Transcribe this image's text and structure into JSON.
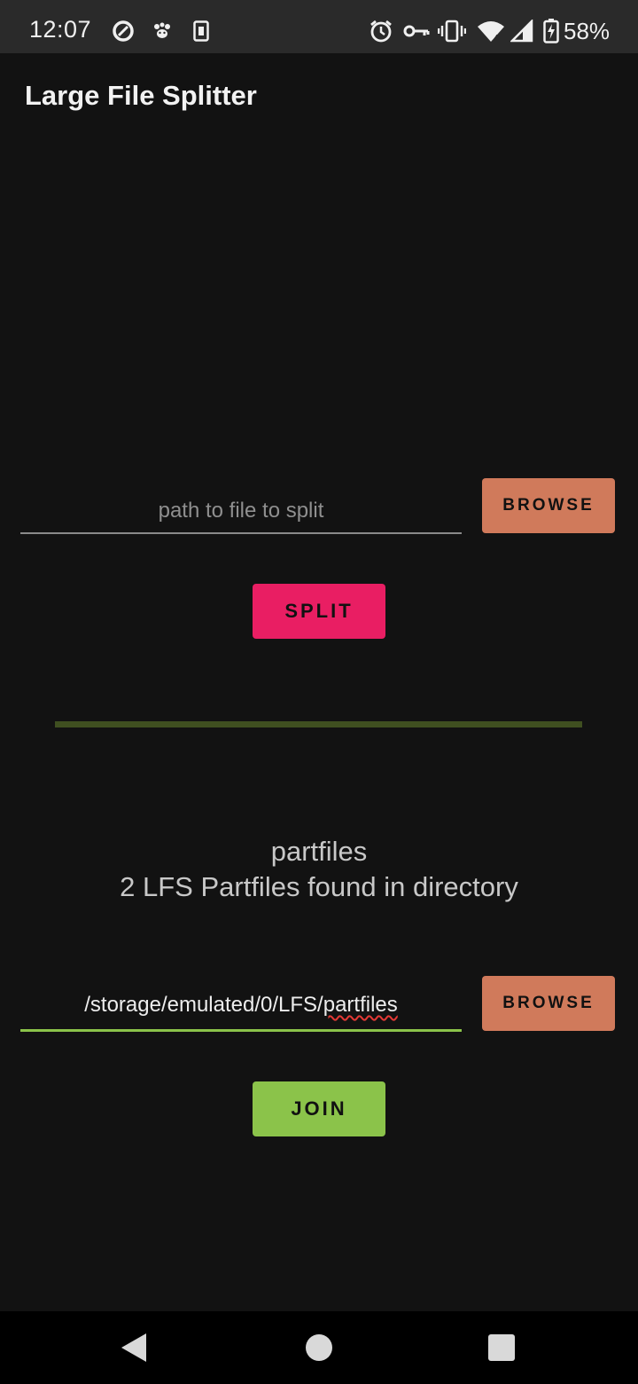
{
  "status_bar": {
    "time": "12:07",
    "battery_percent": "58%",
    "left_icons": [
      "data-saver-icon",
      "paw-icon",
      "sim-card-icon"
    ],
    "right_icons": [
      "alarm-icon",
      "vpn-key-icon",
      "vibrate-icon",
      "wifi-icon",
      "signal-icon",
      "battery-charging-icon"
    ]
  },
  "app_bar": {
    "title": "Large File Splitter"
  },
  "split_section": {
    "input_value": "",
    "input_placeholder": "path to file to split",
    "browse_label": "BROWSE",
    "split_label": "SPLIT",
    "progress": 0
  },
  "join_section": {
    "directory_name": "partfiles",
    "found_text": "2 LFS Partfiles found in directory",
    "path_prefix": "/storage/emulated/0/LFS/",
    "path_last": "partfiles",
    "browse_label": "BROWSE",
    "join_label": "JOIN"
  },
  "colors": {
    "background": "#121212",
    "browse_button": "#d07a5b",
    "split_button": "#e91e63",
    "join_button": "#8bc34a",
    "progress_track": "#3f4f20"
  },
  "nav_bar": {
    "buttons": [
      "back-icon",
      "home-icon",
      "recents-icon"
    ]
  }
}
